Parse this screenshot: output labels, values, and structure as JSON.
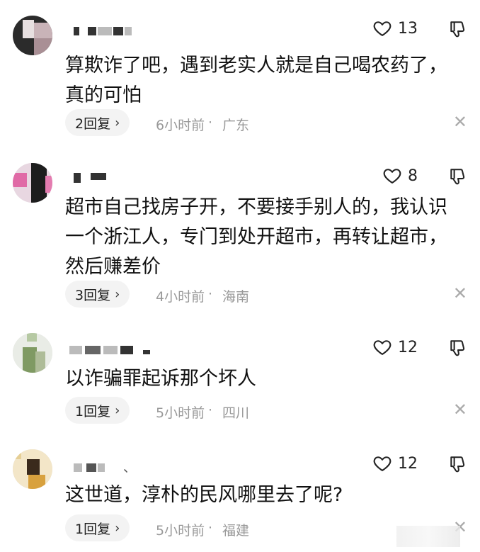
{
  "comments": [
    {
      "likes": "13",
      "text": "算欺诈了吧，遇到老实人就是自己喝农药了，\n真的可怕",
      "reply_label": "2回复",
      "time": "6小时前",
      "separator": "·",
      "location": "广东"
    },
    {
      "likes": "8",
      "text": "超市自己找房子开，不要接手别人的，我认识\n一个浙江人，专门到处开超市，再转让超市，\n然后赚差价",
      "reply_label": "3回复",
      "time": "4小时前",
      "separator": "·",
      "location": "海南"
    },
    {
      "likes": "12",
      "text": "以诈骗罪起诉那个坏人",
      "reply_label": "1回复",
      "time": "5小时前",
      "separator": "·",
      "location": "四川"
    },
    {
      "likes": "12",
      "text": "这世道，淳朴的民风哪里去了呢?",
      "reply_label": "1回复",
      "time": "5小时前",
      "separator": "·",
      "location": "福建"
    }
  ],
  "icons": {
    "like": "heart-outline-icon",
    "dislike": "thumbs-down-icon",
    "close": "close-icon",
    "chevron": "chevron-right-icon"
  }
}
